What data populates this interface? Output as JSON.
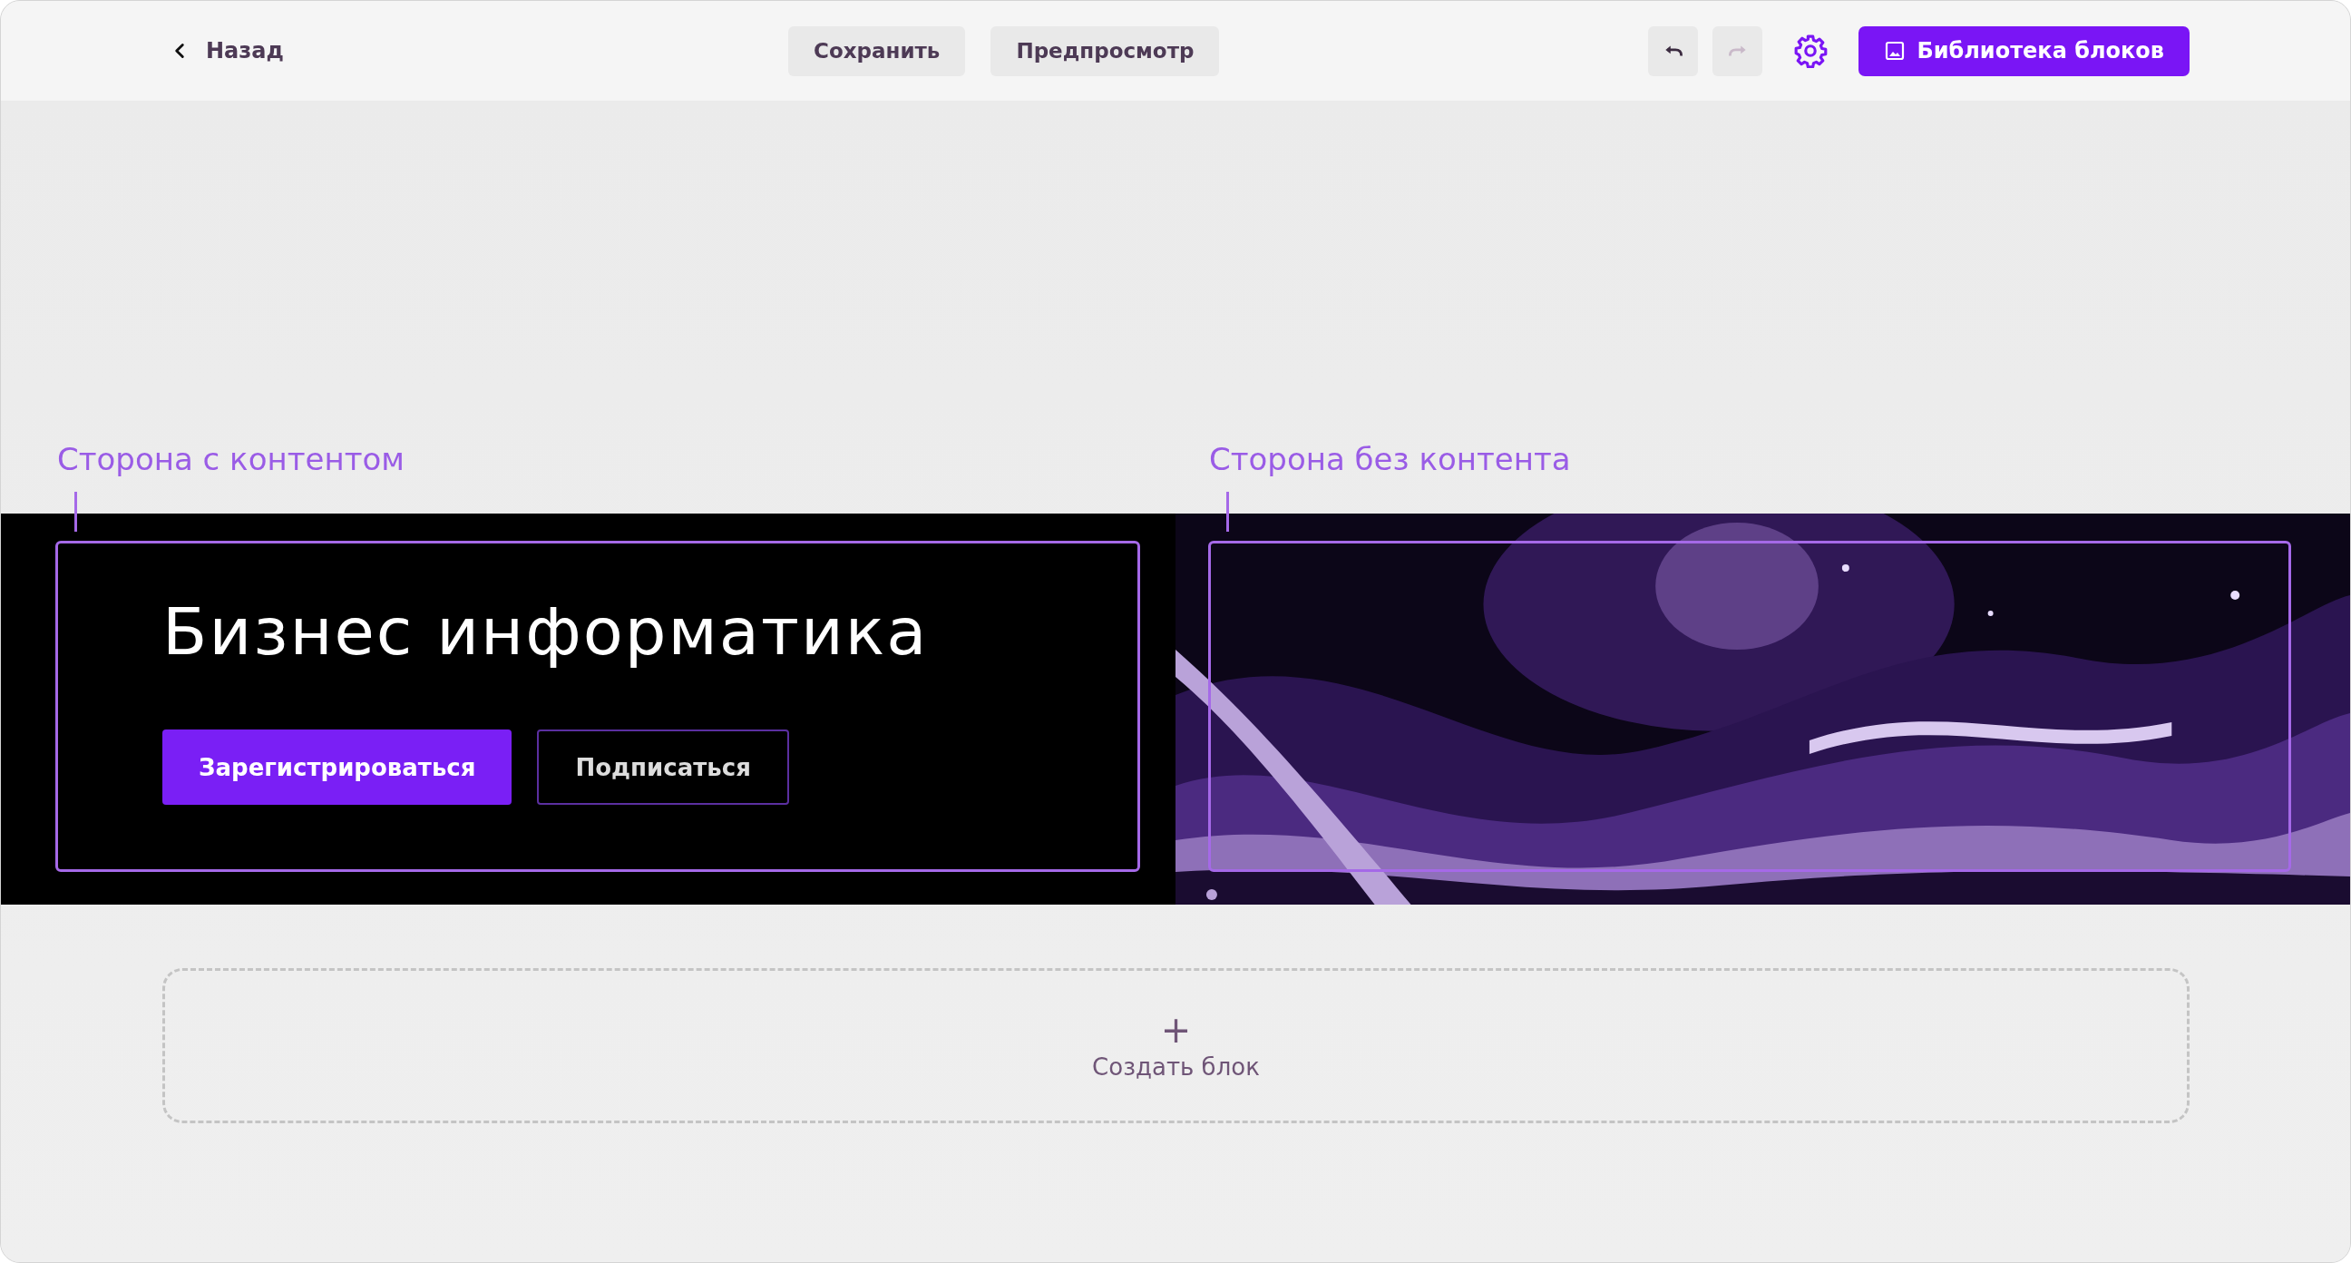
{
  "toolbar": {
    "back": "Назад",
    "actions": [
      {
        "label": "Сохранить"
      },
      {
        "label": "Предпросмотр"
      }
    ],
    "undo": {
      "disabled": false
    },
    "redo": {
      "disabled": true
    },
    "library": "Библиотека блоков"
  },
  "annotations": [
    {
      "label": "Сторона с контентом"
    },
    {
      "label": "Сторона без контента"
    }
  ],
  "hero": {
    "title": "Бизнес информатика",
    "buttons": [
      {
        "label": "Зарегистрироваться",
        "kind": "primary"
      },
      {
        "label": "Подписаться",
        "kind": "outline"
      }
    ]
  },
  "create_block": {
    "icon": "+",
    "label": "Создать блок"
  }
}
